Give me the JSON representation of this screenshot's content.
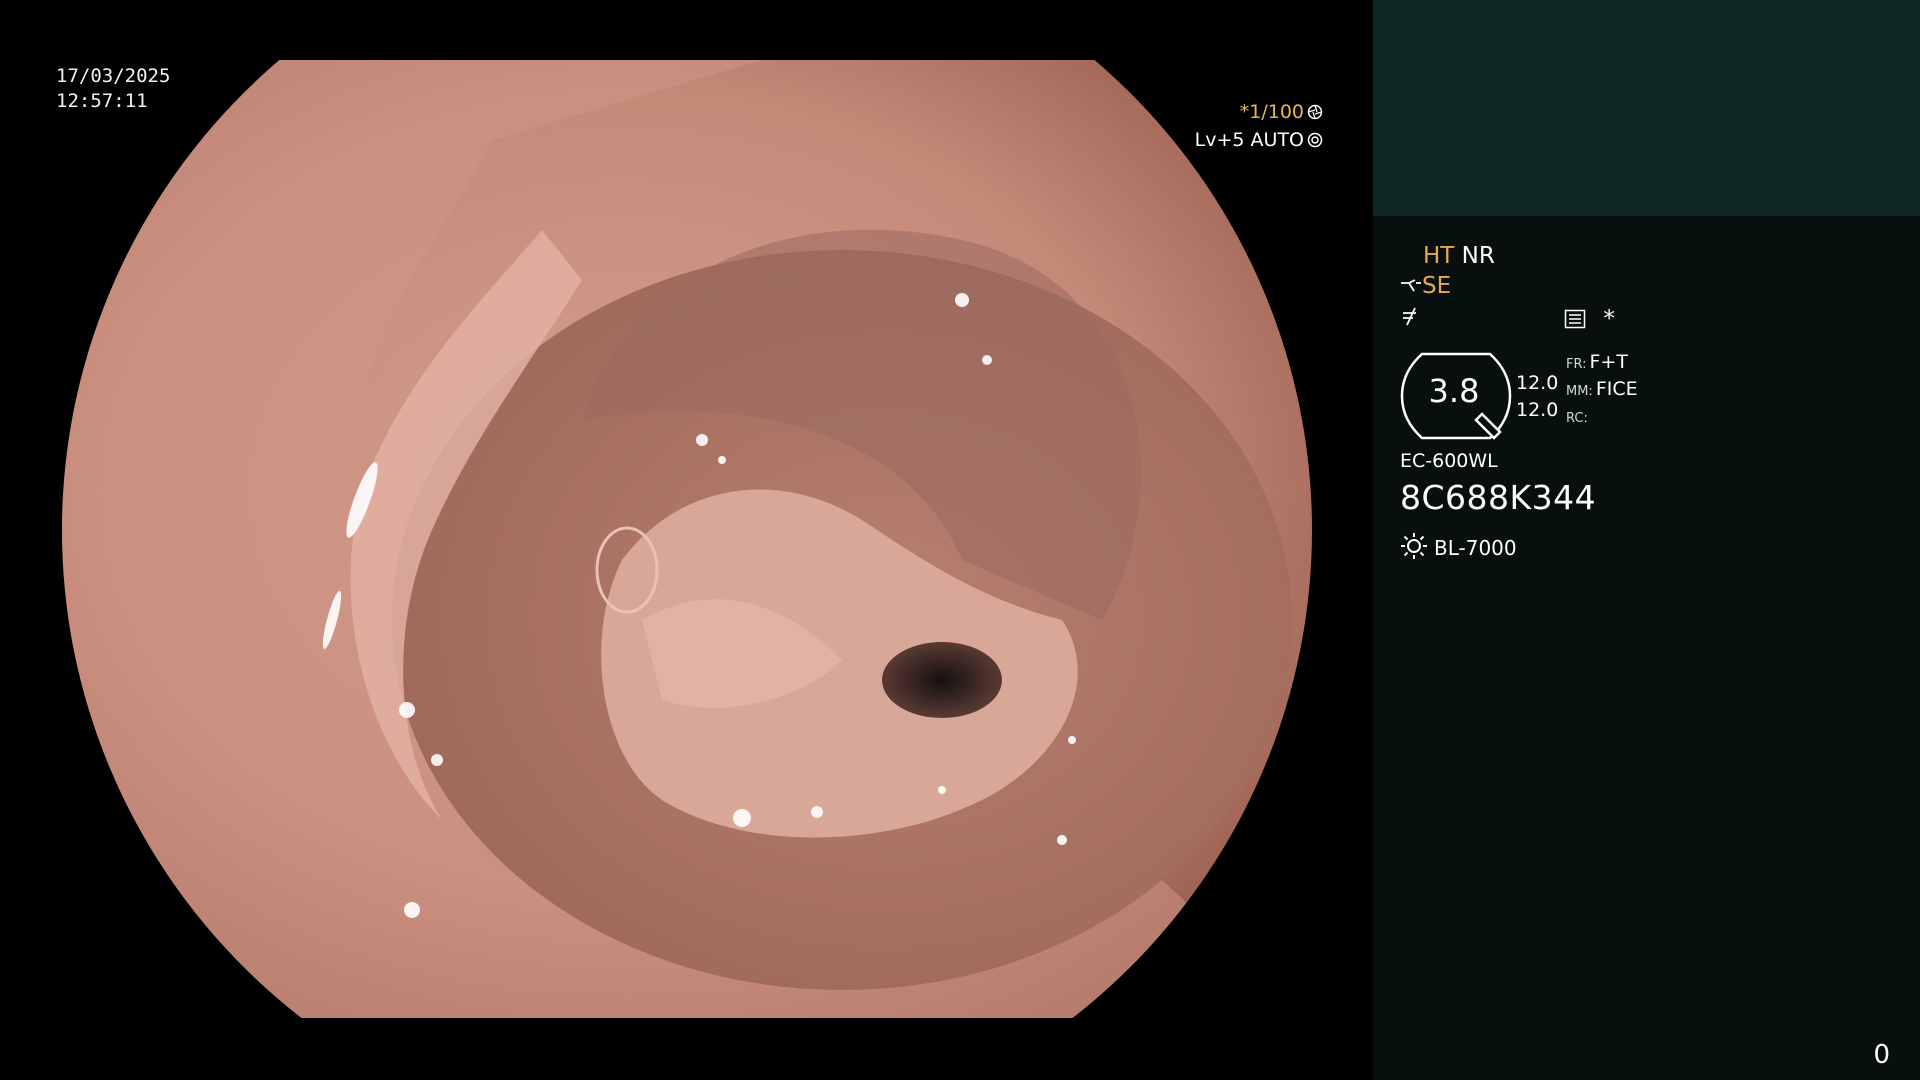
{
  "overlay": {
    "date": "17/03/2025",
    "time": "12:57:11",
    "shutter": "*1/100",
    "level": "Lv+5 AUTO"
  },
  "panel": {
    "ht_label": "HT",
    "nr_label": "NR",
    "se_label": "SE",
    "star": "*",
    "ring_value": "3.8",
    "value_1": "12.0",
    "value_2": "12.0",
    "fr_tag": "FR:",
    "fr_value": "F+T",
    "mm_tag": "MM:",
    "mm_value": "FICE",
    "rc_tag": "RC:",
    "model": "EC-600WL",
    "serial": "8C688K344",
    "light_source": "BL-7000",
    "counter": "0"
  },
  "colors": {
    "panel_bg": "#07100f",
    "panel_top_bg": "#0e2624",
    "accent_orange": "#e7a853",
    "tissue": "#c9907e"
  },
  "icons": [
    "aperture-icon",
    "iris-icon",
    "scope-tip-icon",
    "zoom-icon",
    "menu-icon",
    "lamp-icon"
  ]
}
